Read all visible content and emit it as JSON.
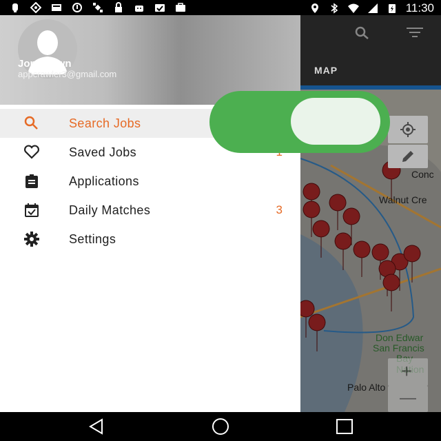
{
  "status_bar": {
    "time": "11:30",
    "left_icons": [
      "notification-icon",
      "location-icon",
      "storage-icon",
      "update-icon",
      "satellite-icon",
      "lock-icon",
      "android-icon",
      "checklist-icon",
      "briefcase-icon"
    ],
    "right_icons": [
      "location-pin-icon",
      "bluetooth-icon",
      "wifi-icon",
      "signal-icon",
      "battery-charging-icon"
    ]
  },
  "app": {
    "tab_label": "MAP",
    "map_labels": [
      "Conc",
      "Walnut Cre",
      "Don Edwar",
      "San Francis",
      "Bay Nation",
      "Palo Alto"
    ],
    "map_buttons": [
      "my-location-button",
      "draw-button",
      "zoom-in-button",
      "zoom-out-button"
    ],
    "zoom_in_label": "+",
    "zoom_out_label": "—"
  },
  "drawer": {
    "user_name": "Jon Brown",
    "user_email": "appcrawler3@gmail.com",
    "items": [
      {
        "label": "Search Jobs",
        "icon": "search-icon",
        "badge": "",
        "active": true
      },
      {
        "label": "Saved Jobs",
        "icon": "heart-icon",
        "badge": "1",
        "active": false
      },
      {
        "label": "Applications",
        "icon": "clipboard-icon",
        "badge": "",
        "active": false
      },
      {
        "label": "Daily Matches",
        "icon": "calendar-check-icon",
        "badge": "3",
        "active": false
      },
      {
        "label": "Settings",
        "icon": "gear-icon",
        "badge": "",
        "active": false
      }
    ]
  },
  "toggle": {
    "state": "on",
    "color": "#4caf50"
  },
  "nav_bar": [
    "back-button",
    "home-button",
    "recents-button"
  ],
  "colors": {
    "accent": "#e66a25",
    "toggle": "#4caf50",
    "tab_indicator": "#1a63a8"
  }
}
